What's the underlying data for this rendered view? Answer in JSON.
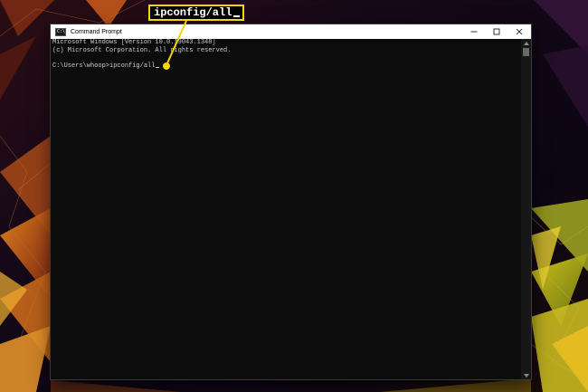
{
  "window": {
    "title": "Command Prompt",
    "app_icon_glyph": "C:\\",
    "icon": "command-prompt-icon"
  },
  "console": {
    "version_line": "Microsoft Windows [Version 10.0.19043.1348]",
    "copyright_line": "(c) Microsoft Corporation. All rights reserved.",
    "prompt": "C:\\Users\\whoop>",
    "command": "ipconfig/all"
  },
  "callout": {
    "text": "ipconfig/all"
  },
  "colors": {
    "console_background": "#0c0c0c",
    "console_text": "#cccccc",
    "callout_accent": "#f5d50a",
    "title_bar": "#ffffff"
  }
}
